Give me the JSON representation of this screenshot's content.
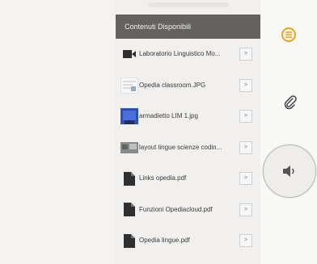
{
  "panel": {
    "title": "Contenuti Disponibili",
    "items": [
      {
        "label": "Laboratorio Linguistico Mo...",
        "icon": "video-icon",
        "button": ">"
      },
      {
        "label": "Opedia classroom.JPG",
        "icon": "image-thumbnail-icon",
        "button": ">"
      },
      {
        "label": "armadietto LIM 1.jpg",
        "icon": "image-thumbnail-icon",
        "button": ">"
      },
      {
        "label": "layout lingue scienze codin...",
        "icon": "image-thumbnail-icon",
        "button": ">"
      },
      {
        "label": "Links opedia.pdf",
        "icon": "document-icon",
        "button": ">"
      },
      {
        "label": "Funzioni Opediacloud.pdf",
        "icon": "document-icon",
        "button": ">"
      },
      {
        "label": "Opedia lingue.pdf",
        "icon": "document-icon",
        "button": ">"
      }
    ]
  },
  "rail": {
    "menu_icon": "menu-circle-icon",
    "attach_icon": "paperclip-icon",
    "audio_icon": "speaker-icon",
    "accent_color": "#e8a317"
  }
}
